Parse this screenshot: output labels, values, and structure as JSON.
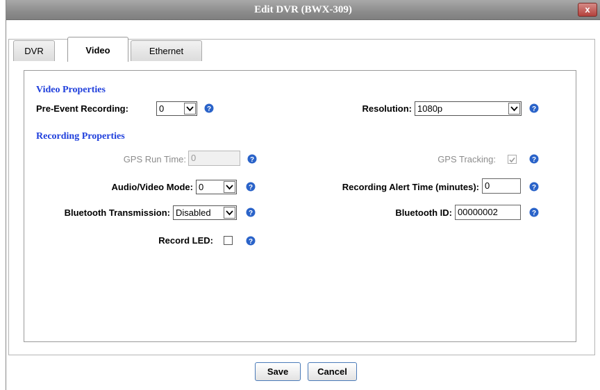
{
  "window": {
    "title": "Edit DVR (BWX-309)",
    "close_label": "x"
  },
  "tabs": [
    {
      "label": "DVR"
    },
    {
      "label": "Video"
    },
    {
      "label": "Ethernet"
    }
  ],
  "video_properties": {
    "heading": "Video Properties",
    "pre_event_label": "Pre-Event Recording:",
    "pre_event_value": "0",
    "resolution_label": "Resolution:",
    "resolution_value": "1080p"
  },
  "recording_properties": {
    "heading": "Recording Properties",
    "gps_run_time_label": "GPS Run Time:",
    "gps_run_time_value": "0",
    "gps_tracking_label": "GPS Tracking:",
    "gps_tracking_checked": true,
    "audio_video_mode_label": "Audio/Video Mode:",
    "audio_video_mode_value": "0",
    "alert_time_label": "Recording Alert Time (minutes):",
    "alert_time_value": "0",
    "bluetooth_tx_label": "Bluetooth Transmission:",
    "bluetooth_tx_value": "Disabled",
    "bluetooth_id_label": "Bluetooth ID:",
    "bluetooth_id_value": "00000002",
    "record_led_label": "Record LED:",
    "record_led_checked": false
  },
  "footer": {
    "save_label": "Save",
    "cancel_label": "Cancel"
  },
  "colors": {
    "section_heading": "#1f3fdc",
    "help_icon": "#2a63c9",
    "titlebar": "#8c8c8c",
    "close_button": "#b4423d"
  }
}
